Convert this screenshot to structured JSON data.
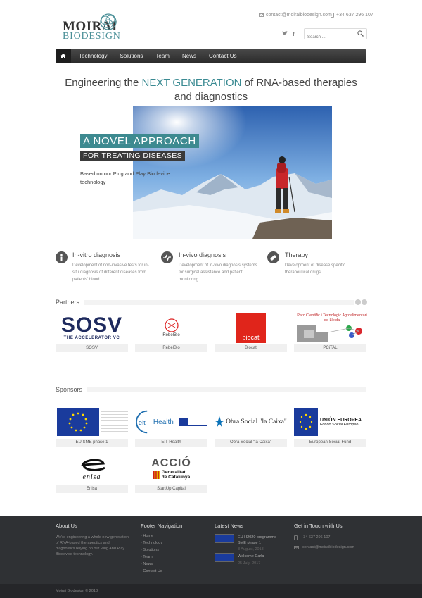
{
  "header": {
    "logo_top": "MOIRAI",
    "logo_bottom": "BIODESIGN",
    "email": "contact@moiraibiodesign.com",
    "phone": "+34 637 296 107",
    "search_placeholder": "Search ...",
    "social": {
      "twitter": "twitter-icon",
      "facebook": "facebook-icon"
    }
  },
  "nav": {
    "items": [
      "Technology",
      "Solutions",
      "Team",
      "News",
      "Contact Us"
    ]
  },
  "hero": {
    "headline_pre": "Engineering the ",
    "headline_accent": "NEXT GENERATION",
    "headline_post": " of RNA-based therapies and diagnostics",
    "title1": "A NOVEL APPROACH",
    "title2": "FOR TREATING DISEASES",
    "subtitle": "Based on our Plug and Play Biodevice technology"
  },
  "features": [
    {
      "title": "In-vitro diagnosis",
      "desc": "Development of non-invasive tests for in-situ diagnosis of different diseases from patients' blood"
    },
    {
      "title": "In-vivo diagnosis",
      "desc": "Development of in-vivo diagnosis systems for surgical assistance and patient monitoring"
    },
    {
      "title": "Therapy",
      "desc": "Development of disease specific therapeutical drugs"
    }
  ],
  "partners": {
    "title": "Partners",
    "items": [
      {
        "caption": "SOSV",
        "logo_text": "SOSV",
        "logo_sub": "THE ACCELERATOR VC"
      },
      {
        "caption": "RebelBio",
        "logo_text": "RebelBio"
      },
      {
        "caption": "Biocat",
        "logo_text": "biocat"
      },
      {
        "caption": "PCiTAL",
        "logo_text": "Parc Científic i Tecnològic Agroalimentari de Lleida"
      }
    ]
  },
  "sponsors": {
    "title": "Sponsors",
    "items": [
      {
        "caption": "EU SME phase 1"
      },
      {
        "caption": "EIT Health",
        "logo_text": "Health"
      },
      {
        "caption": "Obra Social \"la Caixa\"",
        "logo_text": "Obra Social \"la Caixa\""
      },
      {
        "caption": "European Social Fund",
        "logo_text": "UNIÓN EUROPEA",
        "logo_sub": "Fondo Social Europeo"
      },
      {
        "caption": "Enisa",
        "logo_text": "enisa"
      },
      {
        "caption": "StartUp Capital",
        "logo_text": "ACCIÓ",
        "logo_sub1": "Generalitat",
        "logo_sub2": "de Catalunya"
      }
    ]
  },
  "footer": {
    "about_title": "About Us",
    "about_text": "We're engineering a whole new generation of RNA-based therapeutics and diagnostics relying on our Plug And Play Biodevice technology.",
    "nav_title": "Footer Navigation",
    "nav_items": [
      "Home",
      "Technology",
      "Solutions",
      "Team",
      "News",
      "Contact Us"
    ],
    "news_title": "Latest News",
    "news": [
      {
        "title": "EU H2020 programme SME phase 1",
        "date": "8 August, 2018"
      },
      {
        "title": "Welcome Carla",
        "date": "25 July, 2017"
      }
    ],
    "contact_title": "Get in Touch with Us",
    "phone": "+34 637 296 107",
    "email": "contact@moiraibiodesign.com",
    "copyright": "Moirai Biodesign © 2018"
  },
  "colors": {
    "accent": "#3a8a92",
    "nav": "#333333",
    "footer": "#2f3134"
  }
}
